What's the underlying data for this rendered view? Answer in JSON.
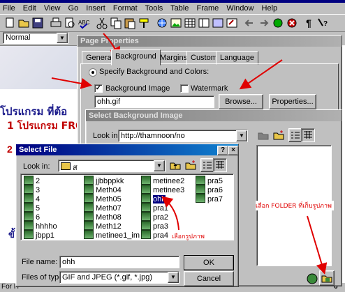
{
  "menu": [
    "File",
    "Edit",
    "View",
    "Go",
    "Insert",
    "Format",
    "Tools",
    "Table",
    "Frame",
    "Window",
    "Help"
  ],
  "style_combo": "Normal",
  "page_properties": {
    "title": "Page Properties",
    "tabs": [
      "General",
      "Background",
      "Margins",
      "Custom",
      "Language"
    ],
    "active_tab": "Background",
    "radio_label": "Specify Background and Colors:",
    "bg_image_label": "Background Image",
    "watermark_label": "Watermark",
    "bg_image_value": "ohh.gif",
    "browse_label": "Browse...",
    "properties_label": "Properties..."
  },
  "select_bg": {
    "title": "Select Background Image",
    "lookin_label": "Look in:",
    "lookin_value": "http://thamnoon/no"
  },
  "select_file": {
    "title": "Select File",
    "lookin_label": "Look in:",
    "lookin_value": "ส",
    "files": [
      [
        "2",
        "jjbbppkk",
        "metinee2",
        "pra5"
      ],
      [
        "3",
        "Meth04",
        "metinee3",
        "pra6"
      ],
      [
        "4",
        "Meth05",
        "ohh",
        "pra7"
      ],
      [
        "5",
        "Meth07",
        "pra1",
        ""
      ],
      [
        "6",
        "Meth08",
        "pra2",
        ""
      ],
      [
        "hhhho",
        "Meth12",
        "pra3",
        ""
      ],
      [
        "jbpp1",
        "metinee1_im",
        "pra4",
        ""
      ]
    ],
    "filename_label": "File name:",
    "filename_value": "ohh",
    "filetype_label": "Files of type:",
    "filetype_value": "GIF and JPEG (*.gif, *.jpg)",
    "ok_label": "OK",
    "cancel_label": "Cancel"
  },
  "annotations": {
    "choose_image": "เลือกรูปภาพ",
    "choose_folder": "เลือก FOLDER ที่เก็บรูปภาพ"
  },
  "background_doc": {
    "line1": "โปรแกรม ที่ต้อ",
    "line2": "1 โปรแกรม FRO",
    "line3": "2",
    "line4": "ขั้"
  },
  "status_left": "For H",
  "status_right": "6"
}
